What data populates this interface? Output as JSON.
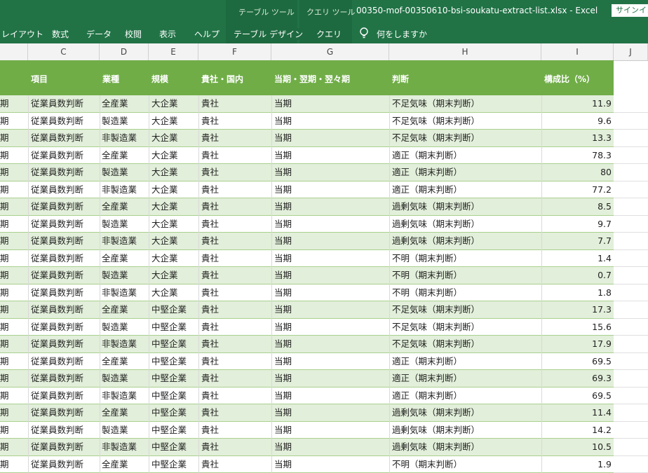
{
  "ribbon": {
    "context_table_label": "テーブル ツール",
    "context_query_label": "クエリ ツール",
    "title": "00350-mof-00350610-bsi-soukatu-extract-list.xlsx  -  Excel",
    "signin": "サインイン",
    "tabs": [
      "レイアウト",
      "数式",
      "データ",
      "校閲",
      "表示",
      "ヘルプ",
      "テーブル デザイン",
      "クエリ"
    ],
    "tell_me": "何をしますか"
  },
  "columns": [
    "C",
    "D",
    "E",
    "F",
    "G",
    "H",
    "I",
    "J"
  ],
  "table": {
    "headers": {
      "item": "項目",
      "industry": "業種",
      "scale": "規模",
      "scope": "貴社・国内",
      "period": "当期・翌期・翌々期",
      "judgment": "判断",
      "ratio": "構成比（%）"
    },
    "rows": [
      {
        "b": "期",
        "item": "従業員数判断",
        "industry": "全産業",
        "scale": "大企業",
        "scope": "貴社",
        "period": "当期",
        "judgment": "不足気味（期末判断）",
        "ratio": "11.9"
      },
      {
        "b": "期",
        "item": "従業員数判断",
        "industry": "製造業",
        "scale": "大企業",
        "scope": "貴社",
        "period": "当期",
        "judgment": "不足気味（期末判断）",
        "ratio": "9.6"
      },
      {
        "b": "期",
        "item": "従業員数判断",
        "industry": "非製造業",
        "scale": "大企業",
        "scope": "貴社",
        "period": "当期",
        "judgment": "不足気味（期末判断）",
        "ratio": "13.3"
      },
      {
        "b": "期",
        "item": "従業員数判断",
        "industry": "全産業",
        "scale": "大企業",
        "scope": "貴社",
        "period": "当期",
        "judgment": "適正（期末判断）",
        "ratio": "78.3"
      },
      {
        "b": "期",
        "item": "従業員数判断",
        "industry": "製造業",
        "scale": "大企業",
        "scope": "貴社",
        "period": "当期",
        "judgment": "適正（期末判断）",
        "ratio": "80"
      },
      {
        "b": "期",
        "item": "従業員数判断",
        "industry": "非製造業",
        "scale": "大企業",
        "scope": "貴社",
        "period": "当期",
        "judgment": "適正（期末判断）",
        "ratio": "77.2"
      },
      {
        "b": "期",
        "item": "従業員数判断",
        "industry": "全産業",
        "scale": "大企業",
        "scope": "貴社",
        "period": "当期",
        "judgment": "過剰気味（期末判断）",
        "ratio": "8.5"
      },
      {
        "b": "期",
        "item": "従業員数判断",
        "industry": "製造業",
        "scale": "大企業",
        "scope": "貴社",
        "period": "当期",
        "judgment": "過剰気味（期末判断）",
        "ratio": "9.7"
      },
      {
        "b": "期",
        "item": "従業員数判断",
        "industry": "非製造業",
        "scale": "大企業",
        "scope": "貴社",
        "period": "当期",
        "judgment": "過剰気味（期末判断）",
        "ratio": "7.7"
      },
      {
        "b": "期",
        "item": "従業員数判断",
        "industry": "全産業",
        "scale": "大企業",
        "scope": "貴社",
        "period": "当期",
        "judgment": "不明（期末判断）",
        "ratio": "1.4"
      },
      {
        "b": "期",
        "item": "従業員数判断",
        "industry": "製造業",
        "scale": "大企業",
        "scope": "貴社",
        "period": "当期",
        "judgment": "不明（期末判断）",
        "ratio": "0.7"
      },
      {
        "b": "期",
        "item": "従業員数判断",
        "industry": "非製造業",
        "scale": "大企業",
        "scope": "貴社",
        "period": "当期",
        "judgment": "不明（期末判断）",
        "ratio": "1.8"
      },
      {
        "b": "期",
        "item": "従業員数判断",
        "industry": "全産業",
        "scale": "中堅企業",
        "scope": "貴社",
        "period": "当期",
        "judgment": "不足気味（期末判断）",
        "ratio": "17.3"
      },
      {
        "b": "期",
        "item": "従業員数判断",
        "industry": "製造業",
        "scale": "中堅企業",
        "scope": "貴社",
        "period": "当期",
        "judgment": "不足気味（期末判断）",
        "ratio": "15.6"
      },
      {
        "b": "期",
        "item": "従業員数判断",
        "industry": "非製造業",
        "scale": "中堅企業",
        "scope": "貴社",
        "period": "当期",
        "judgment": "不足気味（期末判断）",
        "ratio": "17.9"
      },
      {
        "b": "期",
        "item": "従業員数判断",
        "industry": "全産業",
        "scale": "中堅企業",
        "scope": "貴社",
        "period": "当期",
        "judgment": "適正（期末判断）",
        "ratio": "69.5"
      },
      {
        "b": "期",
        "item": "従業員数判断",
        "industry": "製造業",
        "scale": "中堅企業",
        "scope": "貴社",
        "period": "当期",
        "judgment": "適正（期末判断）",
        "ratio": "69.3"
      },
      {
        "b": "期",
        "item": "従業員数判断",
        "industry": "非製造業",
        "scale": "中堅企業",
        "scope": "貴社",
        "period": "当期",
        "judgment": "適正（期末判断）",
        "ratio": "69.5"
      },
      {
        "b": "期",
        "item": "従業員数判断",
        "industry": "全産業",
        "scale": "中堅企業",
        "scope": "貴社",
        "period": "当期",
        "judgment": "過剰気味（期末判断）",
        "ratio": "11.4"
      },
      {
        "b": "期",
        "item": "従業員数判断",
        "industry": "製造業",
        "scale": "中堅企業",
        "scope": "貴社",
        "period": "当期",
        "judgment": "過剰気味（期末判断）",
        "ratio": "14.2"
      },
      {
        "b": "期",
        "item": "従業員数判断",
        "industry": "非製造業",
        "scale": "中堅企業",
        "scope": "貴社",
        "period": "当期",
        "judgment": "過剰気味（期末判断）",
        "ratio": "10.5"
      },
      {
        "b": "期",
        "item": "従業員数判断",
        "industry": "全産業",
        "scale": "中堅企業",
        "scope": "貴社",
        "period": "当期",
        "judgment": "不明（期末判断）",
        "ratio": "1.9"
      }
    ]
  }
}
